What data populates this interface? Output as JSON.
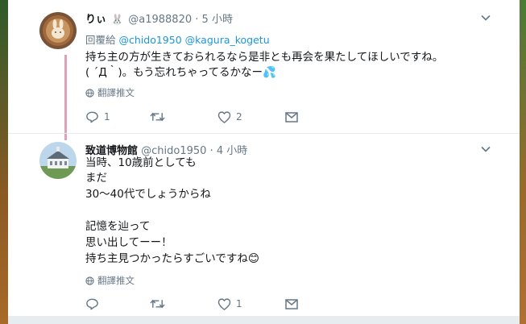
{
  "tweets": [
    {
      "display_name": "りぃ",
      "name_emoji": "🐰",
      "handle": "@a1988820",
      "sep": "·",
      "time": "5 小時",
      "reply_prefix": "回覆給",
      "reply_mentions": [
        "@chido1950",
        "@kagura_kogetu"
      ],
      "lines": [
        "持ち主の方が生きておられるなら是非とも再会を果たしてほしいですね。",
        "( ´Д｀)。もう忘れちゃってるかなー💦"
      ],
      "translate": "翻譯推文",
      "stats": {
        "reply": "1",
        "retweet": "",
        "like": "2"
      }
    },
    {
      "display_name": "致道博物館",
      "handle": "@chido1950",
      "sep": "·",
      "time": "4 小時",
      "lines": [
        "当時、10歳前としても",
        "まだ",
        "30〜40代でしょうからね",
        "",
        "記憶を辿って",
        "思い出してーー！",
        "持ち主見つかったらすごいですね😊"
      ],
      "translate": "翻譯推文",
      "stats": {
        "reply": "",
        "retweet": "",
        "like": "1"
      }
    }
  ],
  "icons": {
    "reply": "reply-icon",
    "retweet": "retweet-icon",
    "like": "heart-icon",
    "dm": "envelope-icon",
    "more": "chevron-down-icon",
    "globe": "globe-icon"
  },
  "colors": {
    "link": "#1b95e0",
    "meta": "#657786",
    "text": "#14171a",
    "thread_line": "#d9a3b8"
  }
}
